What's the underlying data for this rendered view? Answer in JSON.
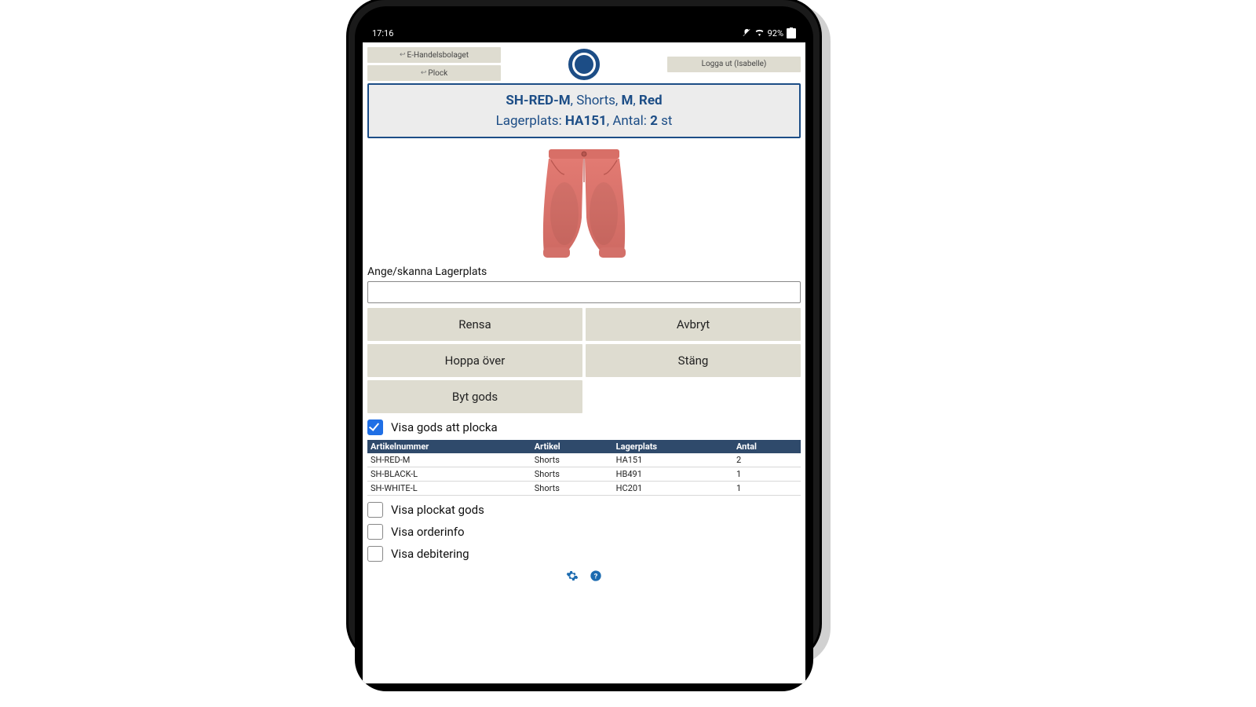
{
  "statusbar": {
    "time": "17:16",
    "battery_pct": "92%"
  },
  "breadcrumb": {
    "company": "E-Handelsbolaget",
    "page": "Plock"
  },
  "logout_label": "Logga ut (Isabelle)",
  "product": {
    "sku": "SH-RED-M",
    "name": "Shorts",
    "size": "M",
    "color": "Red",
    "location_label": "Lagerplats:",
    "location": "HA151",
    "qty_label": "Antal:",
    "qty": "2",
    "qty_unit": "st"
  },
  "input_label": "Ange/skanna Lagerplats",
  "input_value": "",
  "buttons": {
    "clear": "Rensa",
    "cancel": "Avbryt",
    "skip": "Hoppa över",
    "close": "Stäng",
    "swap": "Byt gods"
  },
  "checks": {
    "show_to_pick": "Visa gods att plocka",
    "show_picked": "Visa plockat gods",
    "show_orderinfo": "Visa orderinfo",
    "show_billing": "Visa debitering"
  },
  "table": {
    "headers": [
      "Artikelnummer",
      "Artikel",
      "Lagerplats",
      "Antal"
    ],
    "rows": [
      [
        "SH-RED-M",
        "Shorts",
        "HA151",
        "2"
      ],
      [
        "SH-BLACK-L",
        "Shorts",
        "HB491",
        "1"
      ],
      [
        "SH-WHITE-L",
        "Shorts",
        "HC201",
        "1"
      ]
    ]
  }
}
